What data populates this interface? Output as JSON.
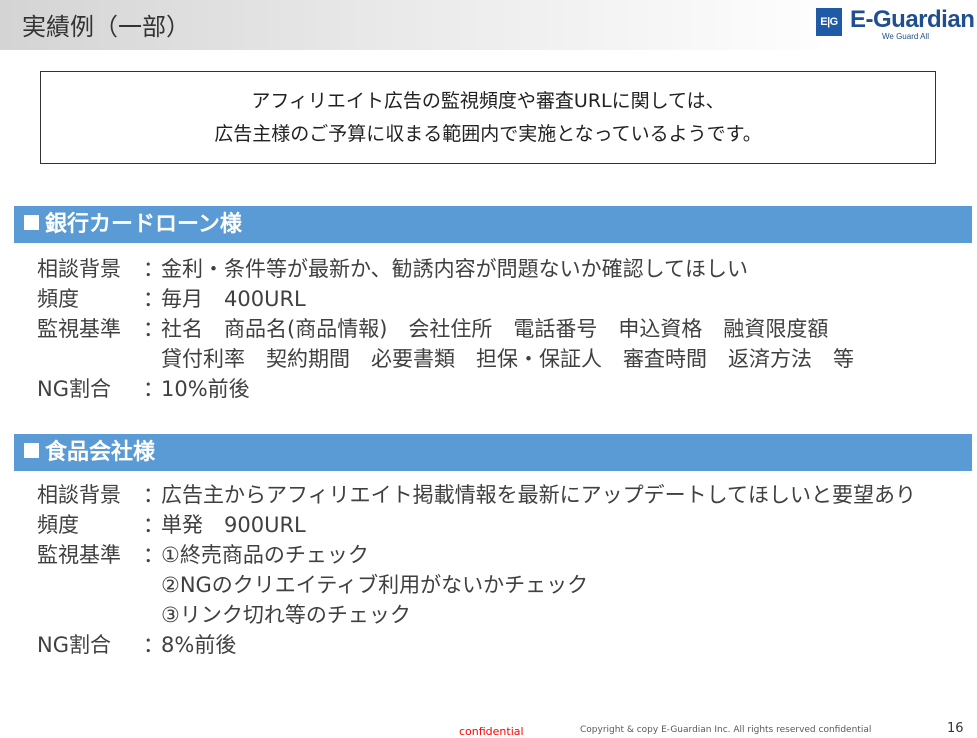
{
  "page_title": "実績例（一部）",
  "logo": {
    "mark": "E|G",
    "name": "E-Guardian",
    "tagline": "We Guard All"
  },
  "summary": [
    "アフィリエイト広告の監視頻度や審査URLに関しては、",
    "広告主様のご予算に収まる範囲内で実施となっているようです。"
  ],
  "sections": [
    {
      "title": "銀行カードローン様",
      "rows": [
        {
          "label": "相談背景",
          "colon": "：",
          "value": "金利・条件等が最新か、勧誘内容が問題ないか確認してほしい"
        },
        {
          "label": "頻度",
          "colon": "：",
          "value": "毎月　400URL"
        },
        {
          "label": "監視基準",
          "colon": "：",
          "value": "社名　商品名(商品情報)　会社住所　電話番号　申込資格　融資限度額"
        },
        {
          "label": "",
          "colon": "",
          "value": "貸付利率　契約期間　必要書類　担保・保証人　審査時間　返済方法　等"
        },
        {
          "label": "NG割合",
          "colon": "：",
          "value": "10%前後"
        }
      ]
    },
    {
      "title": "食品会社様",
      "rows": [
        {
          "label": "相談背景",
          "colon": "：",
          "value": "広告主からアフィリエイト掲載情報を最新にアップデートしてほしいと要望あり"
        },
        {
          "label": "頻度",
          "colon": "：",
          "value": "単発　900URL"
        },
        {
          "label": "監視基準",
          "colon": "：",
          "value": "①終売商品のチェック"
        },
        {
          "label": "",
          "colon": "",
          "value": "②NGのクリエイティブ利用がないかチェック"
        },
        {
          "label": "",
          "colon": "",
          "value": "③リンク切れ等のチェック"
        },
        {
          "label": "NG割合",
          "colon": "：",
          "value": "8%前後"
        }
      ]
    }
  ],
  "footer": {
    "confidential": "confidential",
    "copyright": "Copyright & copy E-Guardian Inc.  All rights reserved  confidential",
    "page_number": "16"
  }
}
